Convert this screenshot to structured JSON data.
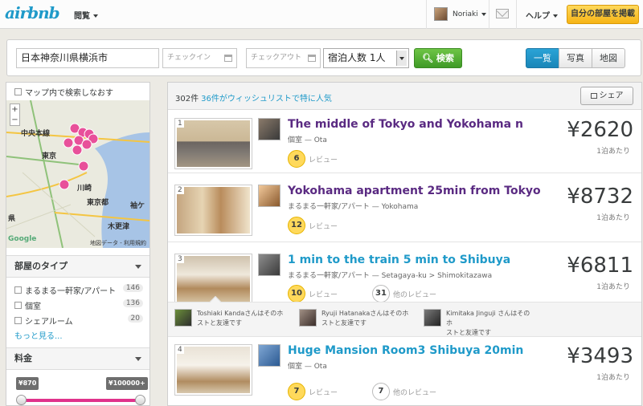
{
  "header": {
    "logo": "airbnb",
    "browse": "閲覧",
    "user_name": "Noriaki",
    "help": "ヘルプ",
    "list_space": "自分の部屋を掲載"
  },
  "search": {
    "location": "日本神奈川県横浜市",
    "checkin_placeholder": "チェックイン",
    "checkout_placeholder": "チェックアウト",
    "guests": "宿泊人数 1人",
    "search_button": "検索",
    "views": [
      "一覧",
      "写真",
      "地図"
    ]
  },
  "sidebar": {
    "map_checkbox": "マップ内で検索しなおす",
    "map_labels": [
      "中央本線",
      "東京",
      "川崎",
      "東京都",
      "木更津",
      "県",
      "袖ケ"
    ],
    "map_footer": "地図データ - 利用規約",
    "map_brand": "Google",
    "room_type_header": "部屋のタイプ",
    "room_types": [
      {
        "label": "まるまる一軒家/アパート",
        "count": "146"
      },
      {
        "label": "個室",
        "count": "136"
      },
      {
        "label": "シェアルーム",
        "count": "20"
      }
    ],
    "more": "もっと見る...",
    "price_header": "料金",
    "price_min": "¥870",
    "price_max": "¥100000+",
    "price_range_fraction": [
      0,
      1
    ]
  },
  "results": {
    "count": "302件",
    "wishlist": "36件がウィッシュリストで特に人気",
    "share": "シェア",
    "review_label": "レビュー",
    "other_review_label": "他のレビュー",
    "per_night": "1泊あたり",
    "listings": [
      {
        "index": "1",
        "title": "The middle of Tokyo and Yokohama n",
        "subtitle": "個室 — Ota",
        "reviews": "6",
        "price": "¥2620",
        "title_color": "#5a2a82"
      },
      {
        "index": "2",
        "title": "Yokohama apartment 25min from Tokyo",
        "subtitle": "まるまる一軒家/アパート — Yokohama",
        "reviews": "12",
        "price": "¥8732",
        "title_color": "#5a2a82"
      },
      {
        "index": "3",
        "title": "1 min to the train 5 min to Shibuya",
        "subtitle": "まるまる一軒家/アパート — Setagaya-ku > Shimokitazawa",
        "reviews": "10",
        "other_reviews": "31",
        "price": "¥6811",
        "title_color": "#1f9ac9"
      },
      {
        "index": "4",
        "title": "Huge Mansion Room3 Shibuya 20min",
        "subtitle": "個室 — Ota",
        "reviews": "7",
        "other_reviews": "7",
        "price": "¥3493",
        "title_color": "#1f9ac9"
      }
    ],
    "friends": [
      {
        "line1": "Toshiaki Kandaさんはそのホ",
        "line2": "ストと友達です"
      },
      {
        "line1": "Ryuji Hatanakaさんはそのホ",
        "line2": "ストと友達です"
      },
      {
        "line1": "Kimitaka Jinguji さんはそのホ",
        "line2": "ストと友達です"
      }
    ]
  }
}
